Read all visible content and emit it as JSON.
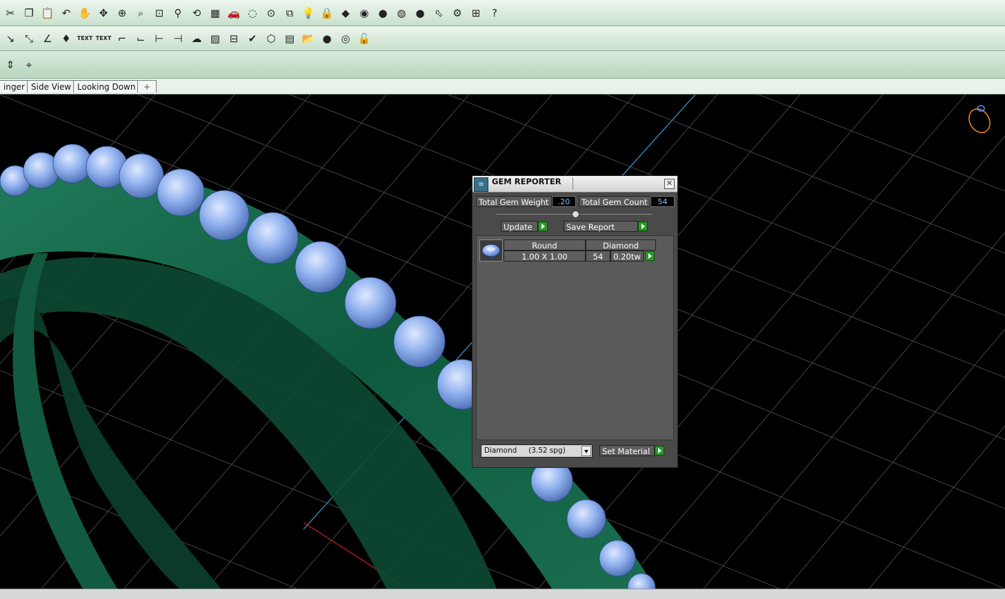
{
  "tabs": [
    "inger",
    "Side View",
    "Looking Down",
    "+"
  ],
  "toolbar1_icons": [
    "cut-icon",
    "copy-icon",
    "paste-icon",
    "undo-icon",
    "pan-hand-icon",
    "rotate-icon",
    "zoom-in-icon",
    "zoom-window-icon",
    "zoom-extents-icon",
    "zoom-selected-icon",
    "view-rotate-icon",
    "grid-icon",
    "render-car-icon",
    "shade-icon",
    "snap-icon",
    "layer-icon",
    "light-bulb-icon",
    "lock-icon",
    "material-icon",
    "color-wheel-icon",
    "sphere-gray-icon",
    "sphere-chrome-icon",
    "sphere-blue-icon",
    "pointer-icon",
    "settings-gear-icon",
    "dimension-icon",
    "help-icon"
  ],
  "toolbar1_glyphs": [
    "✂",
    "❐",
    "📋",
    "↶",
    "✋",
    "✥",
    "⊕",
    "⌕",
    "⊡",
    "⚲",
    "⟲",
    "▦",
    "🚗",
    "◌",
    "⊙",
    "⧉",
    "💡",
    "🔒",
    "◆",
    "◉",
    "●",
    "◍",
    "●",
    "⬁",
    "⚙",
    "⊞",
    "?"
  ],
  "toolbar2_icons": [
    "dim-linear-icon",
    "dim-radius-icon",
    "dim-angle-icon",
    "gem-icon",
    "text-icon",
    "text-outline-icon",
    "leader-icon",
    "callout-icon",
    "measure-icon",
    "measure2-icon",
    "cloud-icon",
    "hatch-icon",
    "align-icon",
    "check-icon",
    "box-icon",
    "table-icon",
    "folder-icon",
    "black-sphere-icon",
    "spiral-icon",
    "unlock-icon"
  ],
  "toolbar2_glyphs": [
    "↘",
    "⤡",
    "∠",
    "♦",
    "TEXT",
    "TEXT",
    "⌐",
    "⌙",
    "⊢",
    "⊣",
    "☁",
    "▨",
    "⊟",
    "✔",
    "⬡",
    "▤",
    "📂",
    "●",
    "◎",
    "🔓"
  ],
  "toolbar3_icons": [
    "snap-vertical-icon",
    "crosshair-icon"
  ],
  "toolbar3_glyphs": [
    "⇕",
    "⌖"
  ],
  "gem_reporter": {
    "title": "GEM REPORTER",
    "close": "✕",
    "total_weight_label": "Total Gem Weight",
    "total_weight_value": ".20",
    "total_count_label": "Total Gem Count",
    "total_count_value": "54",
    "update_label": "Update",
    "save_report_label": "Save Report",
    "row": {
      "shape": "Round",
      "material": "Diamond",
      "size": "1.00 X 1.00",
      "count": "54",
      "weight": "0.20tw"
    },
    "material_select": "Diamond     (3.52 spg)",
    "set_material_label": "Set Material"
  }
}
